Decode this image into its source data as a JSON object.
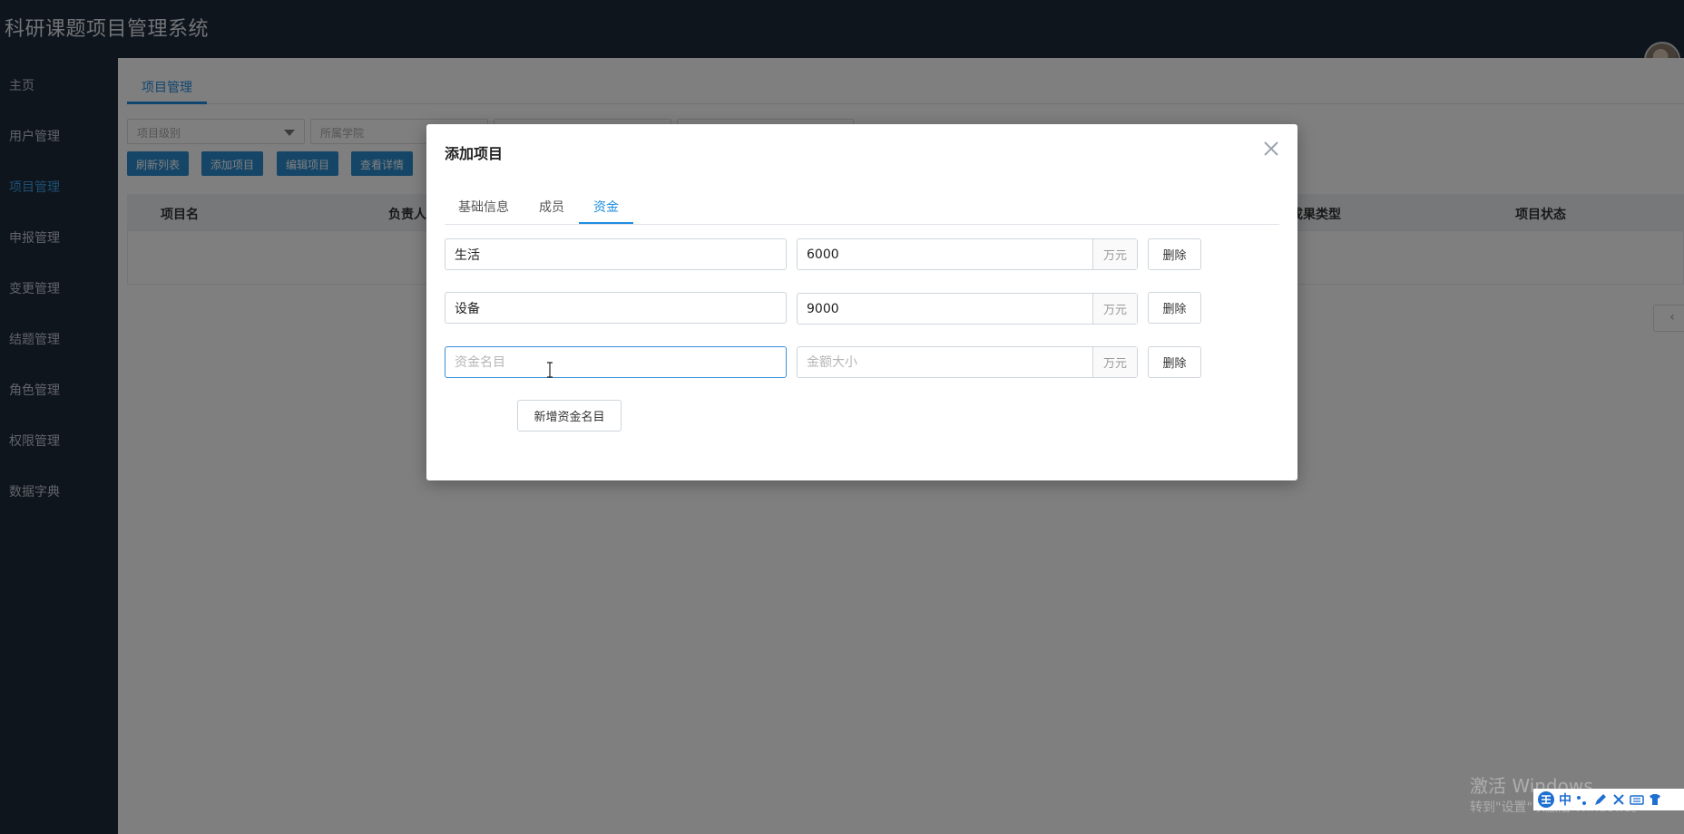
{
  "app": {
    "title": "科研课题项目管理系统"
  },
  "sidebar": {
    "items": [
      {
        "label": "主页",
        "active": false
      },
      {
        "label": "用户管理",
        "active": false
      },
      {
        "label": "项目管理",
        "active": true
      },
      {
        "label": "申报管理",
        "active": false
      },
      {
        "label": "变更管理",
        "active": false
      },
      {
        "label": "结题管理",
        "active": false
      },
      {
        "label": "角色管理",
        "active": false
      },
      {
        "label": "权限管理",
        "active": false
      },
      {
        "label": "数据字典",
        "active": false
      }
    ]
  },
  "main": {
    "tab": "项目管理",
    "filters": [
      {
        "placeholder": "项目级别"
      },
      {
        "placeholder": "所属学院"
      }
    ],
    "buttons": {
      "refresh": "刷新列表",
      "add": "添加项目",
      "edit": "编辑项目",
      "detail": "查看详情"
    },
    "table": {
      "headers": [
        "项目名",
        "负责人",
        "成果类型",
        "项目状态"
      ]
    },
    "pager_prev": "‹"
  },
  "modal": {
    "title": "添加项目",
    "tabs": [
      {
        "label": "基础信息",
        "active": false
      },
      {
        "label": "成员",
        "active": false
      },
      {
        "label": "资金",
        "active": true
      }
    ],
    "funds": [
      {
        "name": "生活",
        "amount": "6000",
        "unit": "万元",
        "delete_label": "删除"
      },
      {
        "name": "设备",
        "amount": "9000",
        "unit": "万元",
        "delete_label": "删除"
      },
      {
        "name": "",
        "amount": "",
        "unit": "万元",
        "delete_label": "删除"
      }
    ],
    "name_placeholder": "资金名目",
    "amount_placeholder": "金额大小",
    "add_fund_label": "新增资金名目"
  },
  "watermark": {
    "line1": "激活 Windows",
    "line2": "转到\"设置\"以激活 Windows。"
  },
  "ime": {
    "icons": [
      "ime-logo-icon",
      "chinese-mode-icon",
      "punctuation-icon",
      "pen-icon",
      "scissors-icon",
      "keyboard-icon",
      "skin-icon"
    ],
    "mode": "中"
  },
  "colors": {
    "sidebar_bg": "#1e2a3b",
    "accent": "#1f8de0",
    "button_blue": "#2d8ccf"
  }
}
